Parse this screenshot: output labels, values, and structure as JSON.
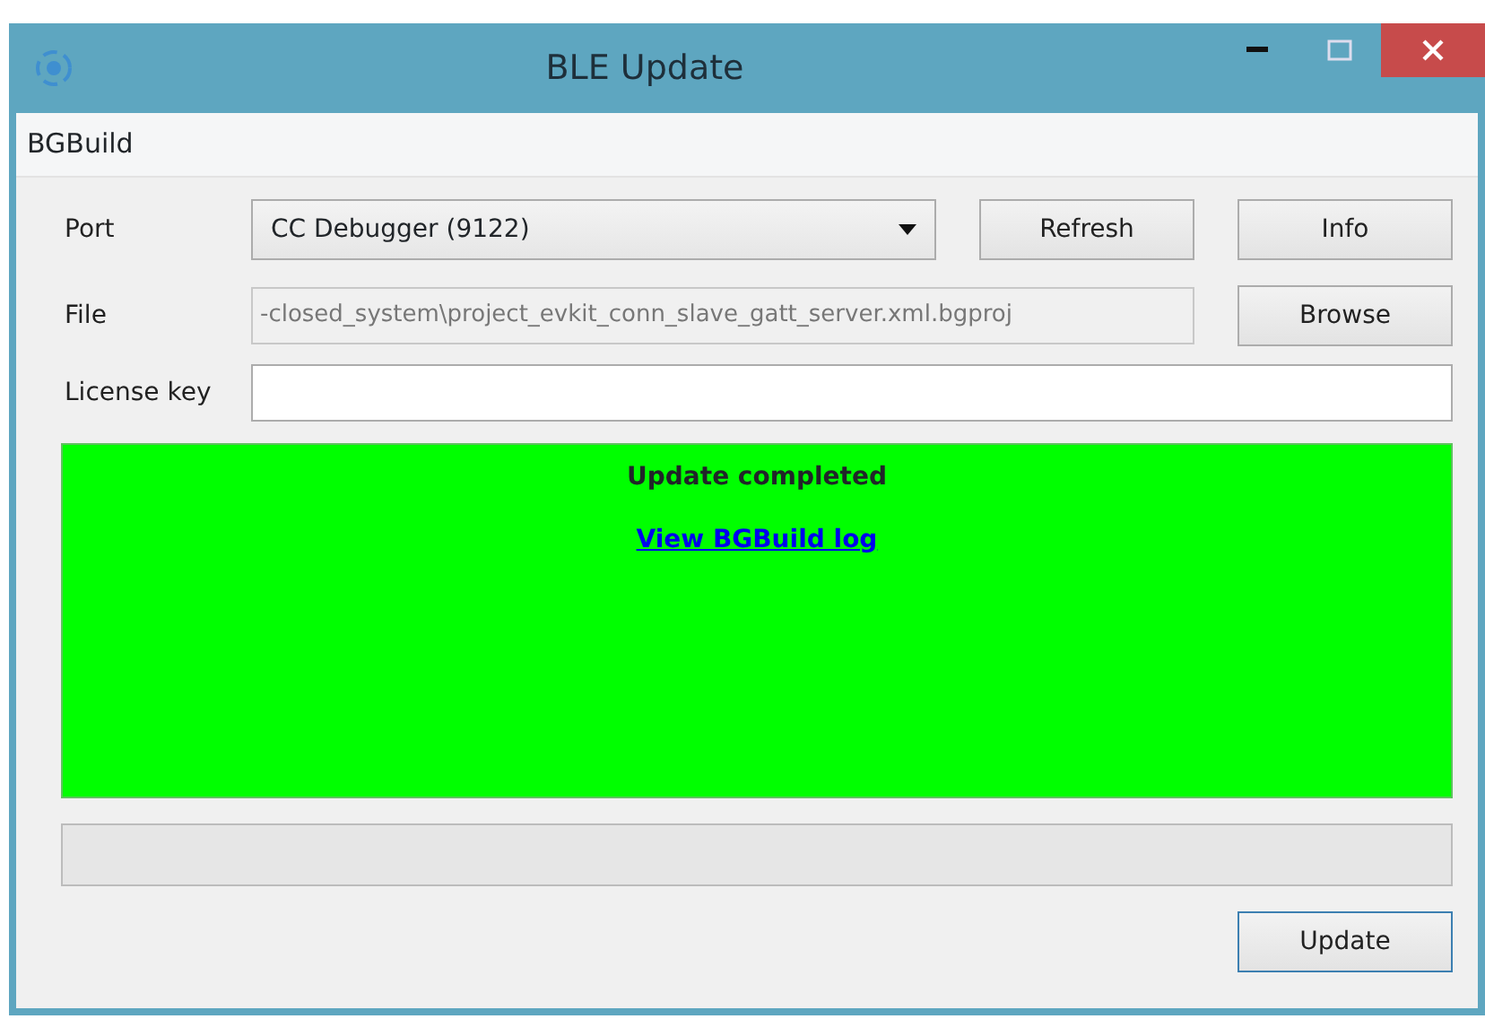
{
  "window": {
    "title": "BLE Update"
  },
  "menu": [
    "BGBuild"
  ],
  "port": {
    "label": "Port",
    "value": "CC Debugger (9122)",
    "buttons": [
      "Refresh",
      "Info"
    ]
  },
  "file": {
    "label": "File",
    "value": "-closed_system\\project_evkit_conn_slave_gatt_server.xml.bgproj",
    "disabled": true,
    "button": "Browse"
  },
  "license": {
    "label": "License key"
  },
  "status": {
    "title": "Update completed",
    "link": "View BGBuild log"
  },
  "update_button": "Update"
}
